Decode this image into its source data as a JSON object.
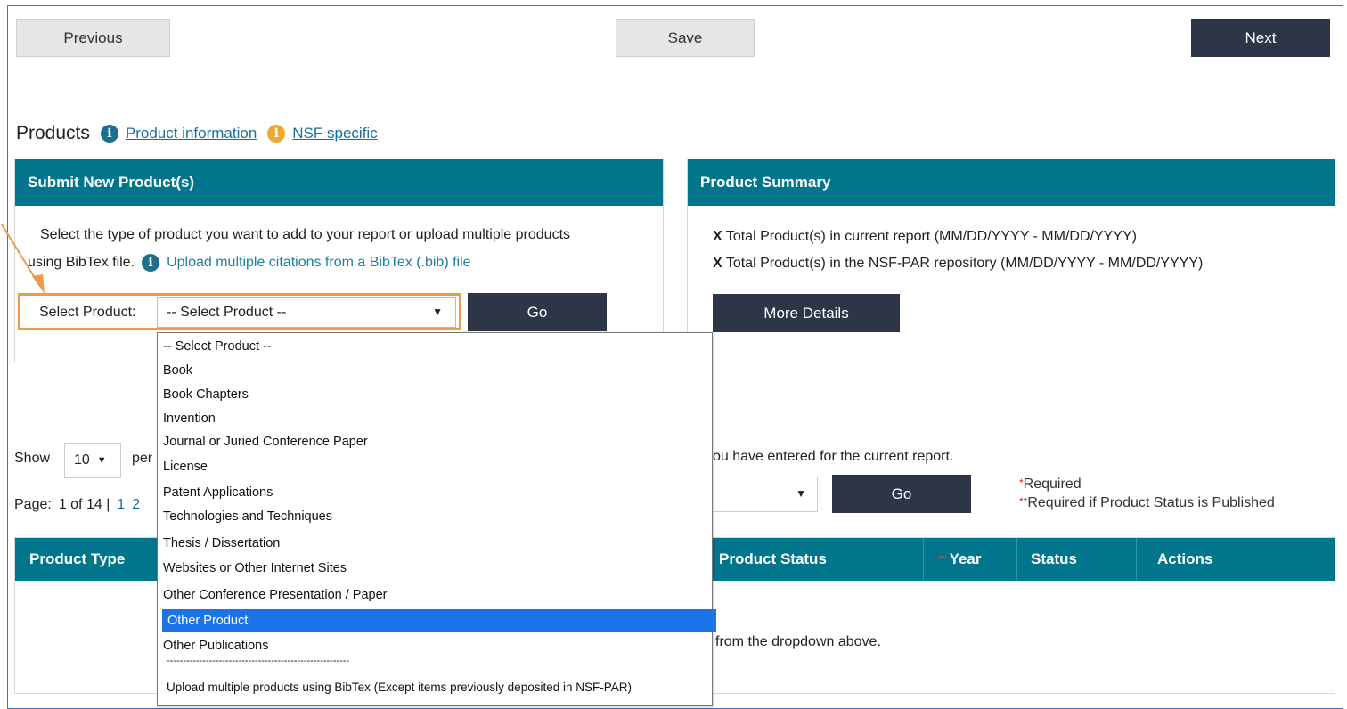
{
  "toolbar": {
    "previous_label": "Previous",
    "save_label": "Save",
    "next_label": "Next"
  },
  "products_header": {
    "title": "Products",
    "product_info_link": "Product information",
    "nsf_specific_link": "NSF specific"
  },
  "submit_panel": {
    "heading": "Submit New Product(s)",
    "instructions_line1": "Select the type of product you want to add to your report or upload multiple products",
    "instructions_line2": "using BibTex file.",
    "upload_link": "Upload multiple citations from a BibTex (.bib) file",
    "select_label": "Select Product:",
    "select_value": "-- Select Product --",
    "go_label": "Go"
  },
  "summary_panel": {
    "heading": "Product Summary",
    "line1_mark": "X",
    "line1": "Total Product(s) in current report  (MM/DD/YYYY -  MM/DD/YYYY)",
    "line2_mark": "X",
    "line2": "Total Product(s) in the NSF-PAR repository  (MM/DD/YYYY -  MM/DD/YYYY)",
    "more_details_label": "More Details"
  },
  "listing": {
    "show_label": "Show",
    "per_page_value": "10",
    "per_fragment": "per",
    "entered_text": "ou have entered  for the current report.",
    "page_label": "Page:",
    "page_info": "1 of 14 |",
    "page_links": [
      "1",
      "2"
    ],
    "go_label": "Go",
    "required_mark": "*",
    "required_text": "Required",
    "required_published_mark": "**",
    "required_published_text": "Required if Product Status is Published",
    "empty_text": "from the dropdown above."
  },
  "table": {
    "columns": [
      "Product Type",
      "Product Status",
      "Year",
      "Status",
      "Actions"
    ],
    "year_mark": "**"
  },
  "dropdown": {
    "options": [
      "-- Select Product --",
      "Book",
      "Book Chapters",
      "Invention",
      "Journal or Juried Conference Paper",
      "License",
      "Patent Applications",
      "Technologies and Techniques",
      "Thesis / Dissertation",
      "Websites or Other Internet Sites",
      "Other Conference Presentation / Paper",
      "Other Product",
      "Other Publications",
      "--------------------------------------------------------",
      "Upload multiple products using BibTex (Except items previously deposited in NSF-PAR)"
    ],
    "selected_index": 11
  },
  "colors": {
    "teal_header": "#00758b",
    "dark_button": "#2e3547",
    "highlight_orange": "#f0994a",
    "selected_option": "#1c75e8",
    "required_red": "#e02020"
  }
}
